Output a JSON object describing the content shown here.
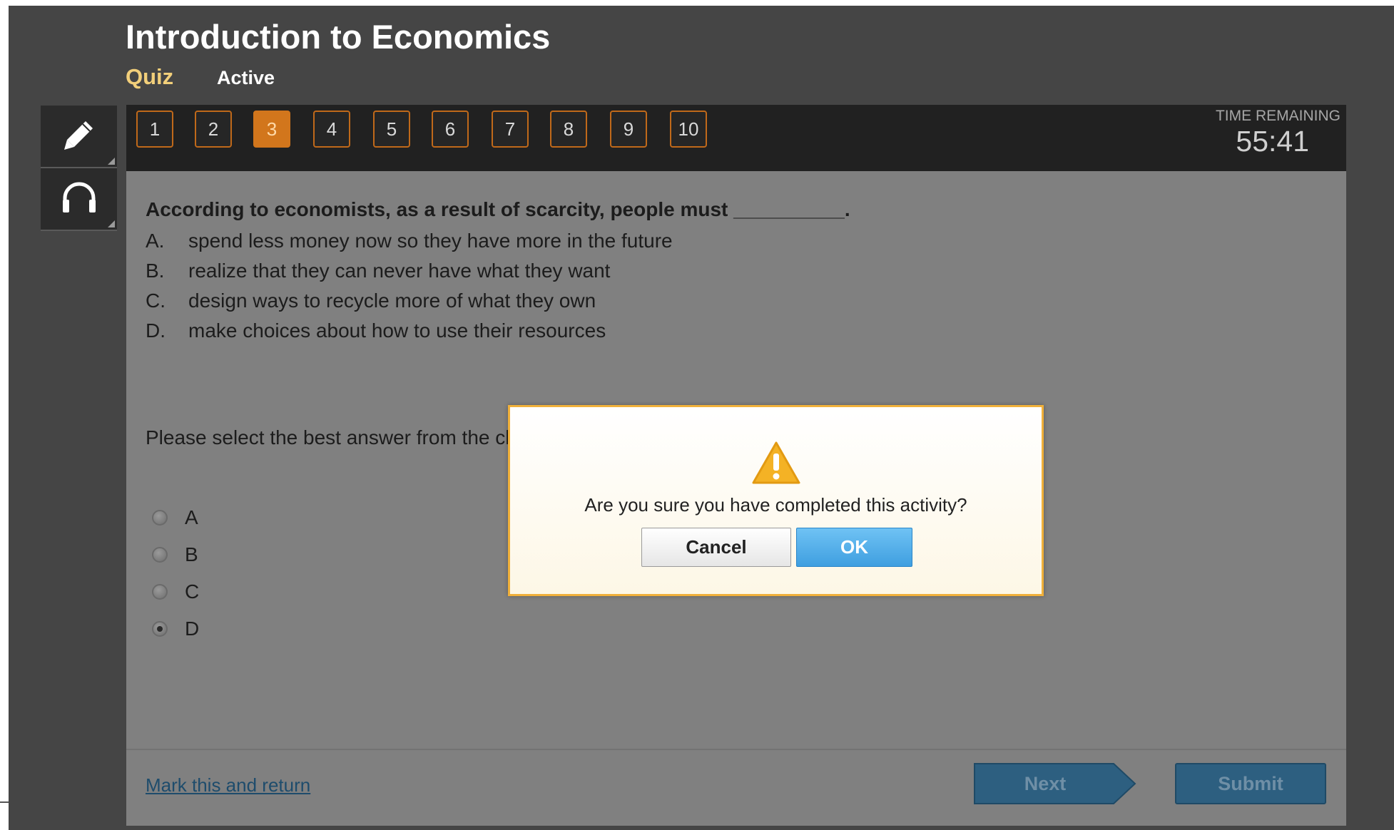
{
  "header": {
    "course_title": "Introduction to Economics",
    "activity_type": "Quiz",
    "activity_status": "Active"
  },
  "tools": [
    {
      "icon": "pencil-icon"
    },
    {
      "icon": "headphones-icon"
    }
  ],
  "question_nav": {
    "current": 3,
    "numbers": [
      "1",
      "2",
      "3",
      "4",
      "5",
      "6",
      "7",
      "8",
      "9",
      "10"
    ]
  },
  "timer": {
    "label": "TIME REMAINING",
    "value": "55:41"
  },
  "question": {
    "prompt": "According to economists, as a result of scarcity, people must __________.",
    "choices": [
      {
        "letter": "A.",
        "text": "spend less money now so they have more in the future"
      },
      {
        "letter": "B.",
        "text": "realize that they can never have what they want"
      },
      {
        "letter": "C.",
        "text": "design ways to recycle more of what they own"
      },
      {
        "letter": "D.",
        "text": "make choices about how to use their resources"
      }
    ],
    "instruction": "Please select the best answer from the choices provided",
    "options": [
      {
        "label": "A",
        "selected": false
      },
      {
        "label": "B",
        "selected": false
      },
      {
        "label": "C",
        "selected": false
      },
      {
        "label": "D",
        "selected": true
      }
    ]
  },
  "footer": {
    "mark_link": "Mark this and return",
    "next_label": "Next",
    "submit_label": "Submit"
  },
  "dialog": {
    "icon": "warning-icon",
    "message": "Are you sure you have completed this activity?",
    "cancel_label": "Cancel",
    "ok_label": "OK"
  },
  "colors": {
    "accent_orange": "#d2761c",
    "dialog_border": "#f0b03a",
    "ok_blue": "#3f9fe0",
    "nav_blue": "#2d5f80"
  }
}
